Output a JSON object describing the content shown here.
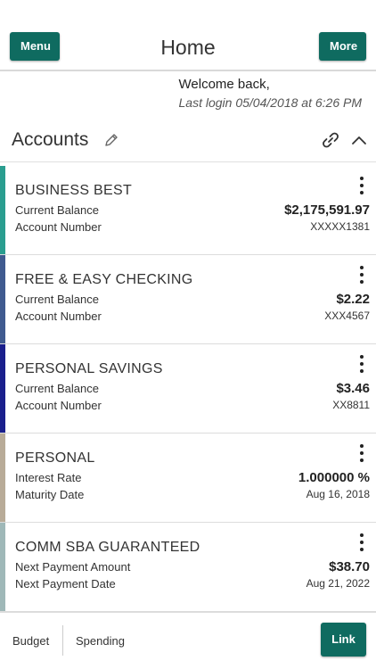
{
  "header": {
    "menu_label": "Menu",
    "title": "Home",
    "more_label": "More"
  },
  "welcome": {
    "greeting": "Welcome back,",
    "last_login": "Last login 05/04/2018 at 6:26 PM"
  },
  "accounts_section": {
    "title": "Accounts",
    "icons": [
      "pencil-icon",
      "link-icon",
      "chevron-up-icon"
    ]
  },
  "accounts": [
    {
      "name": "BUSINESS BEST",
      "label1": "Current Balance",
      "value1": "$2,175,591.97",
      "label2": "Account Number",
      "value2": "XXXXX1381",
      "color": "#2a9d8f"
    },
    {
      "name": "FREE & EASY CHECKING",
      "label1": "Current Balance",
      "value1": "$2.22",
      "label2": "Account Number",
      "value2": "XXX4567",
      "color": "#3f5a8f"
    },
    {
      "name": "PERSONAL SAVINGS",
      "label1": "Current Balance",
      "value1": "$3.46",
      "label2": "Account Number",
      "value2": "XX8811",
      "color": "#1a1f8c"
    },
    {
      "name": "PERSONAL",
      "label1": "Interest Rate",
      "value1": "1.000000 %",
      "label2": "Maturity Date",
      "value2": "Aug 16, 2018",
      "color": "#b8ab98"
    },
    {
      "name": "COMM SBA GUARANTEED",
      "label1": "Next Payment Amount",
      "value1": "$38.70",
      "label2": "Next Payment Date",
      "value2": "Aug 21, 2022",
      "color": "#9fb8b8"
    }
  ],
  "footer": {
    "budget_label": "Budget",
    "spending_label": "Spending",
    "link_label": "Link"
  },
  "colors": {
    "accent": "#0f6b60"
  }
}
